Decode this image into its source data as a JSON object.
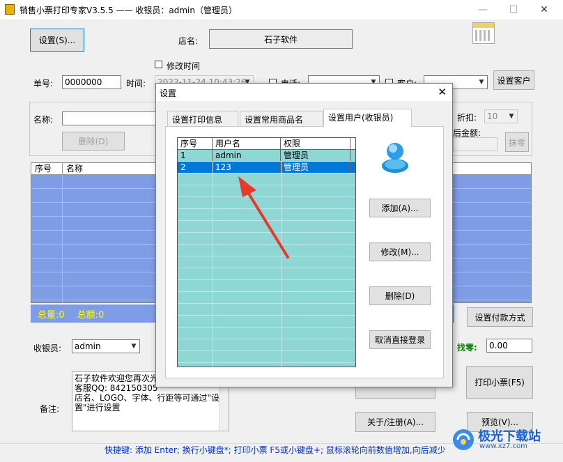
{
  "window": {
    "title": "销售小票打印专家V3.5.5 —— 收银员：admin（管理员）"
  },
  "toolbar": {
    "settings_button": "设置(S)...",
    "shop_label": "店名:",
    "shop_name": "石子软件",
    "modify_time_label": "修改时间"
  },
  "order": {
    "number_label": "单号:",
    "number_value": "0000000",
    "time_label": "时间:",
    "time_value": "2022-11-24 10:43:26",
    "phone_label": "电话:",
    "customer_label": "客户:",
    "set_customer_button": "设置客户"
  },
  "item_entry": {
    "name_label": "名称:",
    "delete_button": "删除(D)",
    "discount_label": "折扣:",
    "discount_value": "10",
    "after_amount_label": "后金额:",
    "erase_zero_button": "抹零"
  },
  "main_table": {
    "columns": [
      "序号",
      "名称"
    ]
  },
  "totals": {
    "qty_label": "总量:0",
    "amount_label": "总额:0"
  },
  "payment": {
    "set_payment_button": "设置付款方式",
    "change_label": "找零:",
    "change_value": "0.00"
  },
  "cashier": {
    "label": "收银员:",
    "value": "admin"
  },
  "notes": {
    "label": "备注:",
    "text": "石子软件欢迎您再次光\n客服QQ: 842150305\n店名、LOGO、字体、行距等可通过\"设置\"进行设置"
  },
  "actions": {
    "print_button": "打印小票(F5)",
    "about_button": "关于/注册(A)...",
    "preview_button": "预览(V)..."
  },
  "status_bar": {
    "text": "快捷键: 添加 Enter; 换行小键盘*; 打印小票 F5或小键盘+; 鼠标滚轮向前数值增加,向后减少"
  },
  "dialog": {
    "title": "设置",
    "tabs": [
      "设置打印信息",
      "设置常用商品名",
      "设置用户(收银员)"
    ],
    "active_tab": 2,
    "grid_columns": [
      "序号",
      "用户名",
      "权限"
    ],
    "users": [
      {
        "no": "1",
        "name": "admin",
        "role": "管理员"
      },
      {
        "no": "2",
        "name": "123",
        "role": "管理员"
      }
    ],
    "add_button": "添加(A)...",
    "modify_button": "修改(M)...",
    "delete_button": "删除(D)",
    "cancel_auto_login_button": "取消直接登录"
  },
  "watermark": {
    "text": "极光下载站",
    "url": "www.xz7.com"
  },
  "colors": {
    "table_blue": "#7f9ce6",
    "grid_teal": "#8fd7d4",
    "selection": "#0078d7",
    "total_text": "#ffff00",
    "status_text": "#0030c8",
    "arrow_red": "#e8392b"
  }
}
